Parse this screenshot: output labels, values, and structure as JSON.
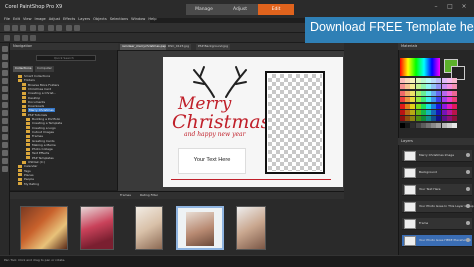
{
  "app": {
    "title": "Corel PaintShop Pro X9"
  },
  "workspace_tabs": [
    "Manage",
    "Adjust",
    "Edit"
  ],
  "menu": [
    "File",
    "Edit",
    "View",
    "Image",
    "Adjust",
    "Effects",
    "Layers",
    "Objects",
    "Selections",
    "Window",
    "Help"
  ],
  "banner": {
    "text": "Download FREE Template here!"
  },
  "navigation": {
    "header": "Navigation",
    "search_placeholder": "Quick Search",
    "tabs": [
      "Collections",
      "Computer"
    ],
    "tree": [
      {
        "label": "Smart Collections",
        "indent": 1
      },
      {
        "label": "Folders",
        "indent": 1
      },
      {
        "label": "Browse More Folders",
        "indent": 2
      },
      {
        "label": "Christmas Card",
        "indent": 2
      },
      {
        "label": "Creating a Christ...",
        "indent": 2
      },
      {
        "label": "Desktop",
        "indent": 2
      },
      {
        "label": "Documents",
        "indent": 2
      },
      {
        "label": "Downloads",
        "indent": 2
      },
      {
        "label": "Merry Christmas",
        "indent": 2,
        "selected": true
      },
      {
        "label": "PSP Tutorials",
        "indent": 2
      },
      {
        "label": "Building a Portfolio",
        "indent": 3
      },
      {
        "label": "Creating a Template",
        "indent": 3
      },
      {
        "label": "Creating a Logo",
        "indent": 3
      },
      {
        "label": "Cutout Images",
        "indent": 3
      },
      {
        "label": "Frames",
        "indent": 3
      },
      {
        "label": "Greeting Cards",
        "indent": 3
      },
      {
        "label": "Making a Meme",
        "indent": 3
      },
      {
        "label": "Photo Collage",
        "indent": 3
      },
      {
        "label": "Text Effects",
        "indent": 3
      },
      {
        "label": "PSP Templates",
        "indent": 3
      },
      {
        "label": "OSDisk (C:)",
        "indent": 2
      },
      {
        "label": "Calendar",
        "indent": 1
      },
      {
        "label": "Tags",
        "indent": 1
      },
      {
        "label": "Places",
        "indent": 1
      },
      {
        "label": "People",
        "indent": 1
      },
      {
        "label": "My Rating",
        "indent": 1
      }
    ]
  },
  "documents": {
    "tabs": [
      {
        "label": "reindeer_merrychristmas.psp",
        "active": true
      },
      {
        "label": "DSC_0123.jpg"
      },
      {
        "label": "PSP Background.jpg"
      }
    ]
  },
  "card": {
    "line1": "Merry",
    "line2": "Christmas",
    "line3": "and happy new year",
    "text_box": "Your Text Here"
  },
  "organizer": {
    "label": "Frames",
    "filter": "Rating Filter",
    "thumb_count": 6
  },
  "materials": {
    "header": "Materials"
  },
  "layers": {
    "header": "Layers",
    "rows": [
      {
        "name": "Merry Christmas Image",
        "active": false
      },
      {
        "name": "Background",
        "active": false
      },
      {
        "name": "Your Text Here",
        "active": false
      },
      {
        "name": "Your Photo Goes In This Layer Group",
        "active": false
      },
      {
        "name": "Frame",
        "active": false
      },
      {
        "name": "Your Photo Goes HERE Placeholder",
        "active": true
      }
    ]
  },
  "status": {
    "text": "Pan Tool: Click and drag to pan or rotate."
  },
  "colors": {
    "accent": "#e0631d",
    "banner": "#2f80b6",
    "christmas_red": "#c0202a",
    "selection": "#3477c9"
  }
}
